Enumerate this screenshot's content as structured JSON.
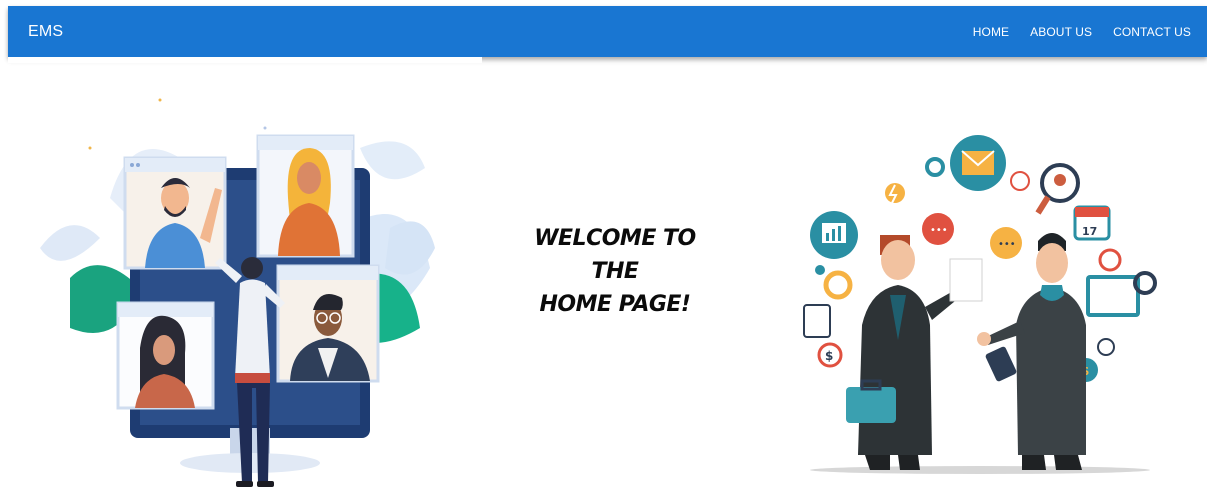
{
  "navbar": {
    "brand": "EMS",
    "links": [
      "HOME",
      "ABOUT US",
      "CONTACT US"
    ]
  },
  "main": {
    "welcome_lines": [
      "WELCOME TO",
      "THE",
      "HOME PAGE!"
    ]
  },
  "colors": {
    "navbar_bg": "#1976d2",
    "text_on_primary": "#ffffff",
    "heading_text": "#0b0b0b"
  },
  "images": {
    "left": "video-conference-illustration",
    "right": "business-meeting-illustration"
  }
}
